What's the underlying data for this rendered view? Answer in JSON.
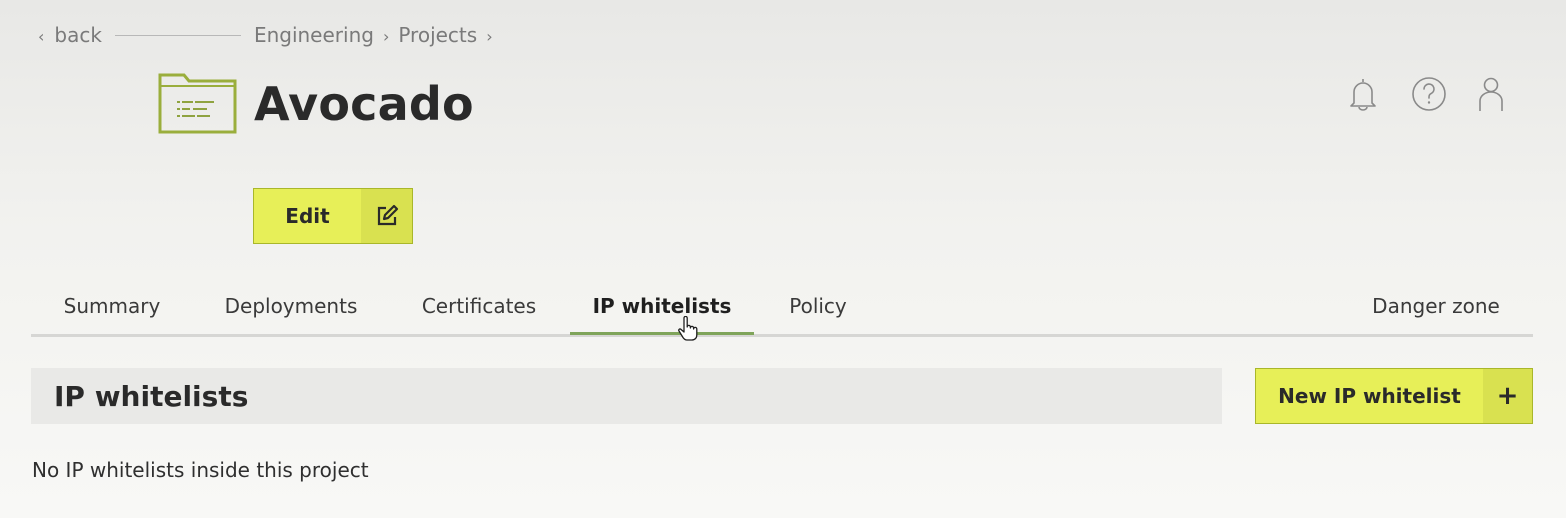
{
  "nav": {
    "back_label": "back",
    "breadcrumbs": [
      "Engineering",
      "Projects"
    ]
  },
  "project": {
    "title": "Avocado",
    "icon": "folder-icon"
  },
  "header_icons": [
    "bell-icon",
    "help-icon",
    "user-icon"
  ],
  "edit_button": {
    "label": "Edit",
    "icon": "edit-icon"
  },
  "tabs": [
    {
      "label": "Summary"
    },
    {
      "label": "Deployments"
    },
    {
      "label": "Certificates"
    },
    {
      "label": "IP whitelists",
      "active": true
    },
    {
      "label": "Policy"
    },
    {
      "label": "Danger zone"
    }
  ],
  "section": {
    "title": "IP whitelists",
    "new_button_label": "New IP whitelist",
    "new_button_icon": "+",
    "empty_message": "No IP whitelists inside this project"
  },
  "colors": {
    "accent": "#e7ef58",
    "accent_dark": "#d9e150",
    "tab_underline": "#7fa45a",
    "folder_outline": "#9aae3c"
  }
}
